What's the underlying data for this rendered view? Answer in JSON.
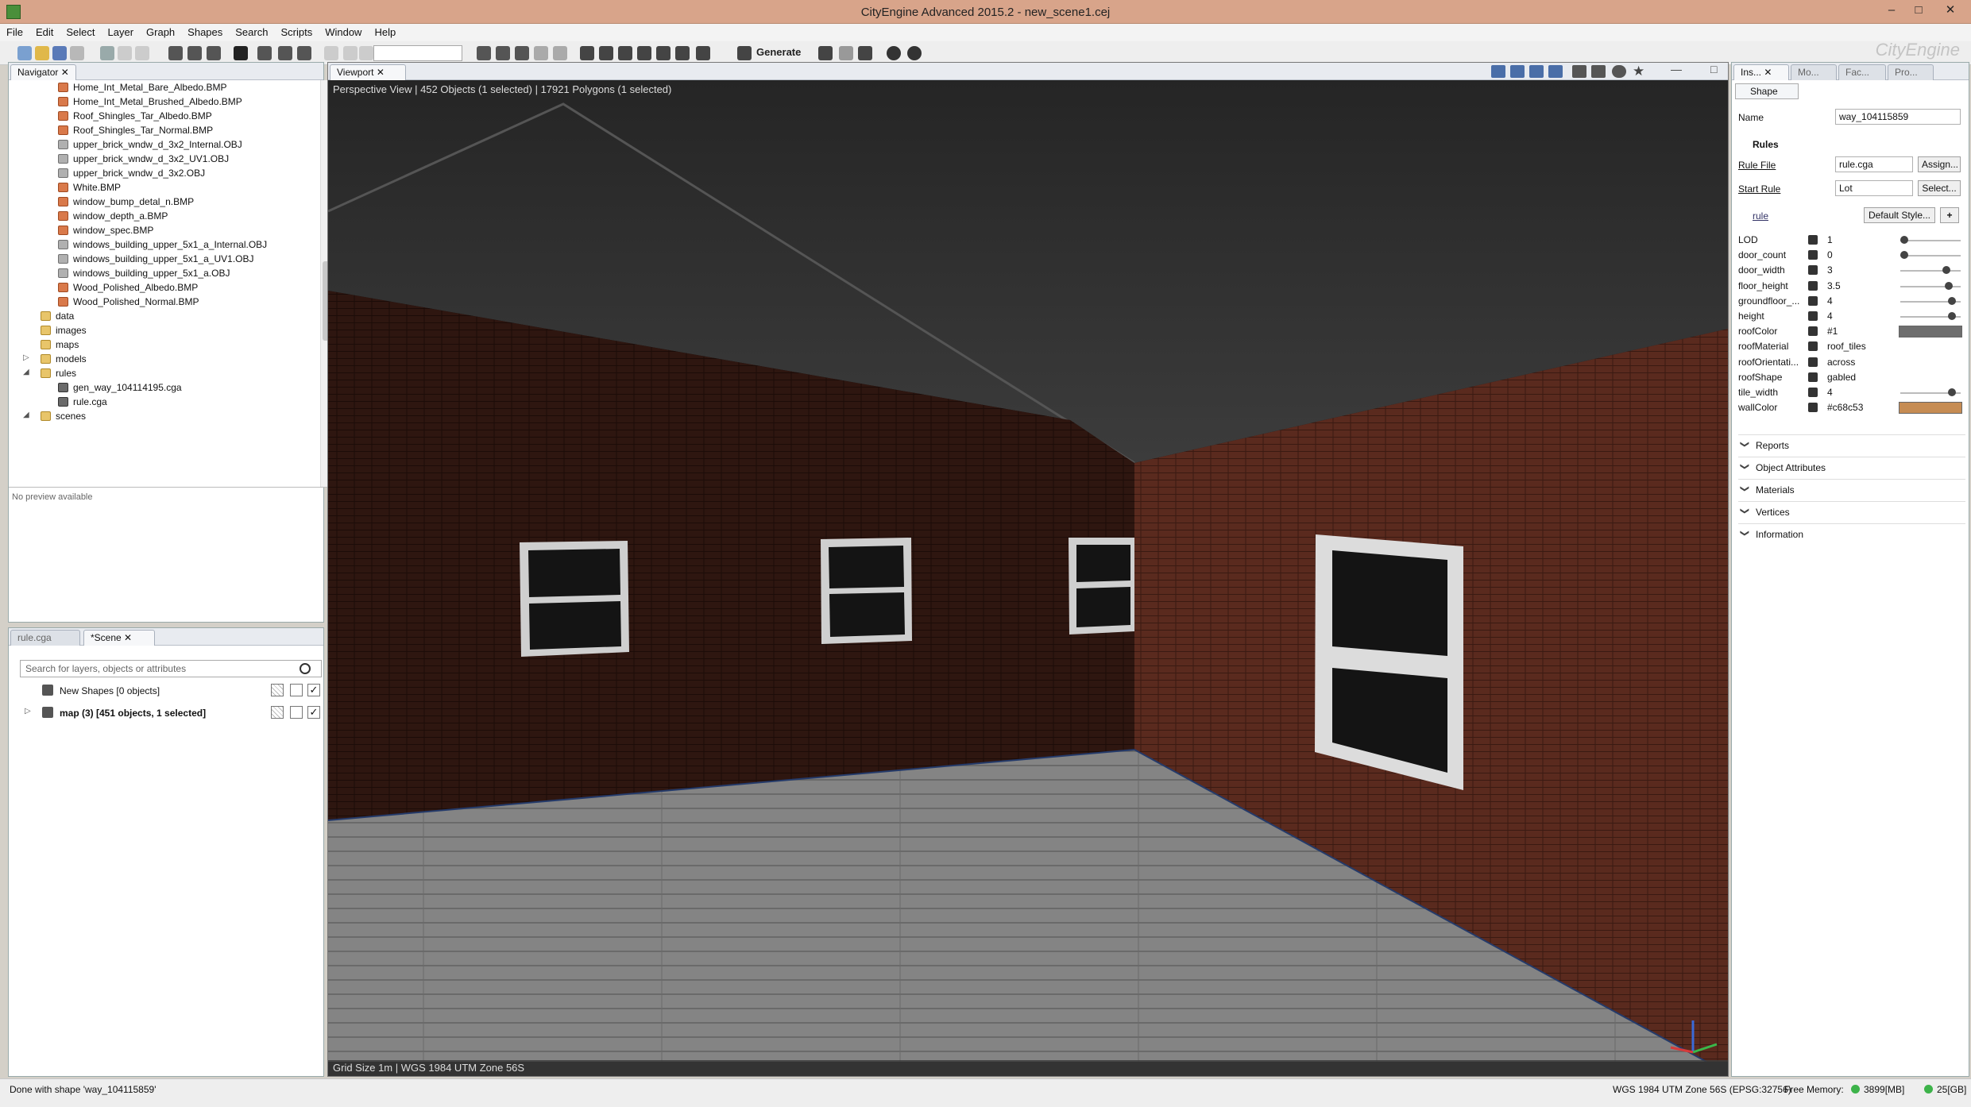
{
  "window": {
    "title": "CityEngine Advanced 2015.2 - new_scene1.cej",
    "minimize": "–",
    "maximize": "□",
    "close": "✕"
  },
  "menu": [
    "File",
    "Edit",
    "Select",
    "Layer",
    "Graph",
    "Shapes",
    "Search",
    "Scripts",
    "Window",
    "Help"
  ],
  "toolbar": {
    "generate_label": "Generate",
    "brand": "CityEngine"
  },
  "navigator": {
    "tab_label": "Navigator",
    "items": [
      {
        "label": "Home_Int_Metal_Bare_Albedo.BMP",
        "kind": "file",
        "indent": 2
      },
      {
        "label": "Home_Int_Metal_Brushed_Albedo.BMP",
        "kind": "file",
        "indent": 2
      },
      {
        "label": "Roof_Shingles_Tar_Albedo.BMP",
        "kind": "file",
        "indent": 2
      },
      {
        "label": "Roof_Shingles_Tar_Normal.BMP",
        "kind": "file",
        "indent": 2
      },
      {
        "label": "upper_brick_wndw_d_3x2_Internal.OBJ",
        "kind": "obj",
        "indent": 2
      },
      {
        "label": "upper_brick_wndw_d_3x2_UV1.OBJ",
        "kind": "obj",
        "indent": 2
      },
      {
        "label": "upper_brick_wndw_d_3x2.OBJ",
        "kind": "obj",
        "indent": 2
      },
      {
        "label": "White.BMP",
        "kind": "file",
        "indent": 2
      },
      {
        "label": "window_bump_detal_n.BMP",
        "kind": "file",
        "indent": 2
      },
      {
        "label": "window_depth_a.BMP",
        "kind": "file",
        "indent": 2
      },
      {
        "label": "window_spec.BMP",
        "kind": "file",
        "indent": 2
      },
      {
        "label": "windows_building_upper_5x1_a_Internal.OBJ",
        "kind": "obj",
        "indent": 2
      },
      {
        "label": "windows_building_upper_5x1_a_UV1.OBJ",
        "kind": "obj",
        "indent": 2
      },
      {
        "label": "windows_building_upper_5x1_a.OBJ",
        "kind": "obj",
        "indent": 2
      },
      {
        "label": "Wood_Polished_Albedo.BMP",
        "kind": "file",
        "indent": 2
      },
      {
        "label": "Wood_Polished_Normal.BMP",
        "kind": "file",
        "indent": 2
      },
      {
        "label": "data",
        "kind": "folder",
        "indent": 1
      },
      {
        "label": "images",
        "kind": "folder",
        "indent": 1
      },
      {
        "label": "maps",
        "kind": "folder",
        "indent": 1
      },
      {
        "label": "models",
        "kind": "folder",
        "indent": 1,
        "caret": "▷"
      },
      {
        "label": "rules",
        "kind": "folder",
        "indent": 1,
        "caret": "◢"
      },
      {
        "label": "gen_way_104114195.cga",
        "kind": "cga",
        "indent": 2
      },
      {
        "label": "rule.cga",
        "kind": "cga",
        "indent": 2
      },
      {
        "label": "scenes",
        "kind": "folder",
        "indent": 1,
        "caret": "◢"
      }
    ],
    "preview_text": "No preview available"
  },
  "scene_panel": {
    "tab_rule": "rule.cga",
    "tab_scene": "*Scene",
    "search_placeholder": "Search for layers, objects or attributes",
    "layers": [
      {
        "label": "New Shapes [0 objects]",
        "bold": false,
        "checked": true
      },
      {
        "label": "map (3) [451 objects, 1 selected]",
        "bold": true,
        "checked": true
      }
    ]
  },
  "viewport": {
    "tab_label": "Viewport",
    "info": "Perspective View  |  452 Objects  (1 selected)  |  17921 Polygons  (1 selected)",
    "status": "Grid Size 1m  |  WGS 1984 UTM Zone 56S"
  },
  "inspector": {
    "tabs": [
      "Ins...",
      "Mo...",
      "Fac...",
      "Pro..."
    ],
    "header": "Shape",
    "name_label": "Name",
    "name_value": "way_104115859",
    "rules_header": "Rules",
    "rule_file_label": "Rule File",
    "rule_file_value": "rule.cga",
    "assign_label": "Assign...",
    "start_rule_label": "Start Rule",
    "start_rule_value": "Lot",
    "select_label": "Select...",
    "rule_section": "rule",
    "style_label": "Default Style...",
    "add_label": "+",
    "attrs": [
      {
        "name": "LOD",
        "value": "1",
        "slider": 0.0
      },
      {
        "name": "door_count",
        "value": "0",
        "slider": 0.0
      },
      {
        "name": "door_width",
        "value": "3",
        "slider": 0.75
      },
      {
        "name": "floor_height",
        "value": "3.5",
        "slider": 0.8
      },
      {
        "name": "groundfloor_...",
        "value": "4",
        "slider": 0.85
      },
      {
        "name": "height",
        "value": "4",
        "slider": 0.85
      },
      {
        "name": "roofColor",
        "value": "#1",
        "swatch": "#6e6e6e"
      },
      {
        "name": "roofMaterial",
        "value": "roof_tiles"
      },
      {
        "name": "roofOrientati...",
        "value": "across"
      },
      {
        "name": "roofShape",
        "value": "gabled"
      },
      {
        "name": "tile_width",
        "value": "4",
        "slider": 0.85
      },
      {
        "name": "wallColor",
        "value": "#c68c53",
        "swatch": "#c68c53"
      }
    ],
    "sections": [
      "Reports",
      "Object Attributes",
      "Materials",
      "Vertices",
      "Information"
    ]
  },
  "status": {
    "message": "Done with shape 'way_104115859'",
    "crs": "WGS 1984 UTM Zone 56S (EPSG:32756)",
    "free_memory_label": "Free Memory:",
    "free_memory": "3899[MB]",
    "disk": "25[GB]"
  }
}
